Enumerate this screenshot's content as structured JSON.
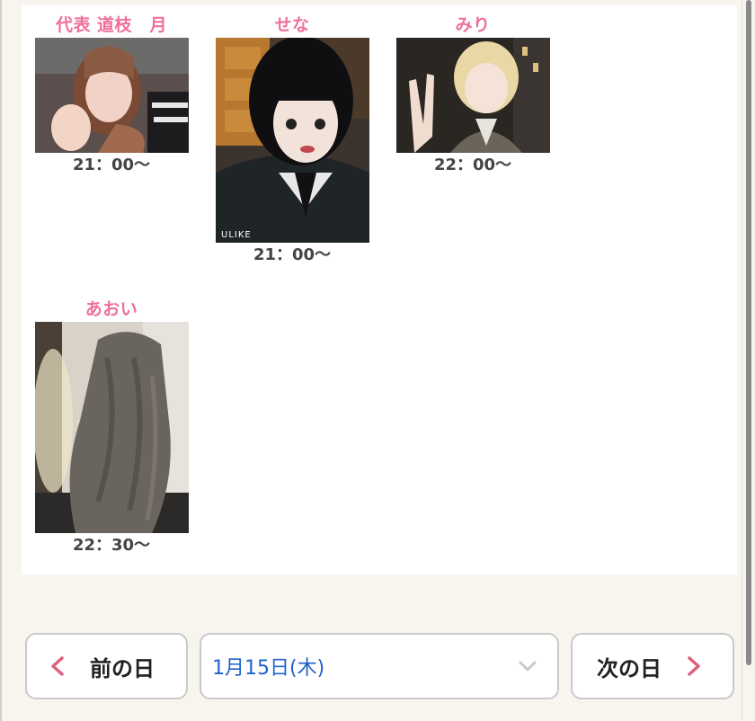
{
  "schedule": {
    "cards": [
      {
        "name": "代表 道枝　月",
        "time": "21：00〜",
        "photo_icon": "portrait-photo"
      },
      {
        "name": "せな",
        "time": "21：00〜",
        "photo_icon": "portrait-photo"
      },
      {
        "name": "みり",
        "time": "22：00〜",
        "photo_icon": "portrait-photo"
      },
      {
        "name": "あおい",
        "time": "22：30〜",
        "photo_icon": "portrait-photo"
      }
    ],
    "photo_watermark": "ULIKE"
  },
  "nav": {
    "prev_label": "前の日",
    "next_label": "次の日",
    "date_value": "1月15日(木)"
  },
  "colors": {
    "name_pink": "#ee7099",
    "chevron_pink": "#e0607e",
    "date_blue": "#1f62c9",
    "background": "#f8f5ef"
  }
}
